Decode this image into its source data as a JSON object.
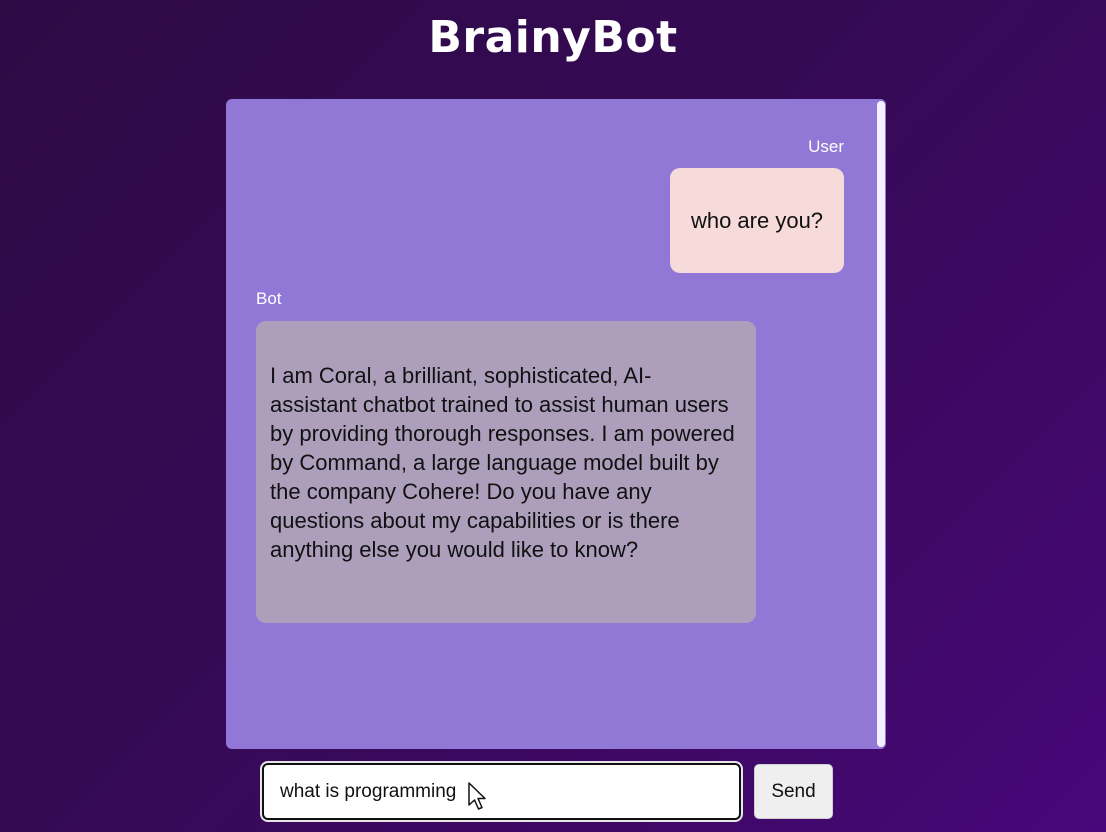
{
  "app": {
    "title": "BrainyBot"
  },
  "chat": {
    "messages": [
      {
        "sender": "User",
        "text": "who are you?"
      },
      {
        "sender": "Bot",
        "text": "I am Coral, a brilliant, sophisticated, AI-assistant chatbot trained to assist human users by providing thorough responses. I am powered by Command, a large language model built by the company Cohere! Do you have any questions about my capabilities or is there anything else you would like to know?"
      }
    ]
  },
  "composer": {
    "input_value": "what is programming",
    "send_label": "Send"
  },
  "icons": {
    "cursor": "mouse-pointer-icon"
  },
  "colors": {
    "background": "#350a55",
    "panel": "#9178d6",
    "user_bubble": "#f7dada",
    "bot_bubble": "#ad9fbc"
  }
}
